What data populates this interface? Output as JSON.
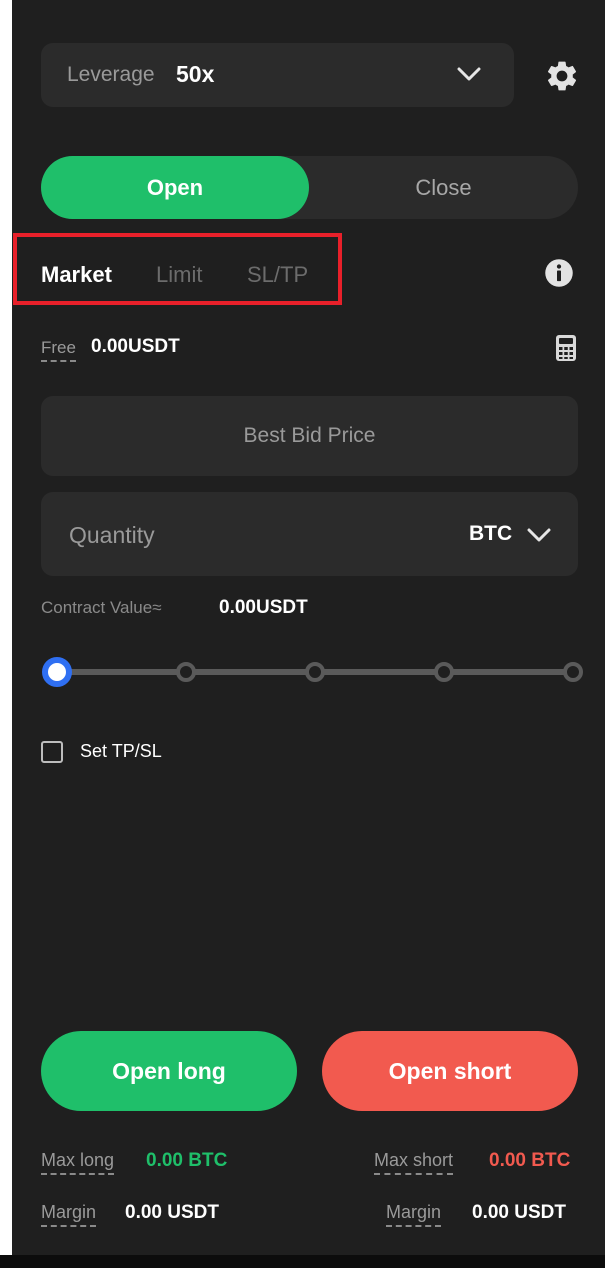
{
  "leverage": {
    "label": "Leverage",
    "value": "50x"
  },
  "mode_toggle": {
    "open_label": "Open",
    "close_label": "Close",
    "selected": "Open"
  },
  "order_tabs": {
    "market": "Market",
    "limit": "Limit",
    "sltp": "SL/TP",
    "selected": "Market"
  },
  "free": {
    "label": "Free",
    "value": "0.00USDT"
  },
  "price_field": {
    "value": "Best Bid Price"
  },
  "quantity": {
    "placeholder": "Quantity",
    "value": "",
    "unit": "BTC"
  },
  "contract_value": {
    "label": "Contract Value≈",
    "value": "0.00USDT"
  },
  "size_slider": {
    "stops": 5,
    "value_fraction": 0
  },
  "tpsl": {
    "label": "Set TP/SL",
    "checked": false
  },
  "buttons": {
    "open_long": "Open long",
    "open_short": "Open short"
  },
  "footer": {
    "max_long_label": "Max long",
    "max_long_value": "0.00 BTC",
    "max_short_label": "Max short",
    "max_short_value": "0.00 BTC",
    "margin_left_label": "Margin",
    "margin_left_value": "0.00 USDT",
    "margin_right_label": "Margin",
    "margin_right_value": "0.00 USDT"
  },
  "colors": {
    "panel_bg": "#1f1f1f",
    "field_bg": "#2b2b2b",
    "accent_green": "#1fbf6a",
    "accent_red": "#f25a4f",
    "slider_active": "#2f6ff2",
    "highlight": "#e8202a"
  },
  "icons": {
    "settings": "gear-icon",
    "info": "info-icon",
    "calculator": "calculator-icon",
    "dropdown": "chevron-down-icon"
  }
}
